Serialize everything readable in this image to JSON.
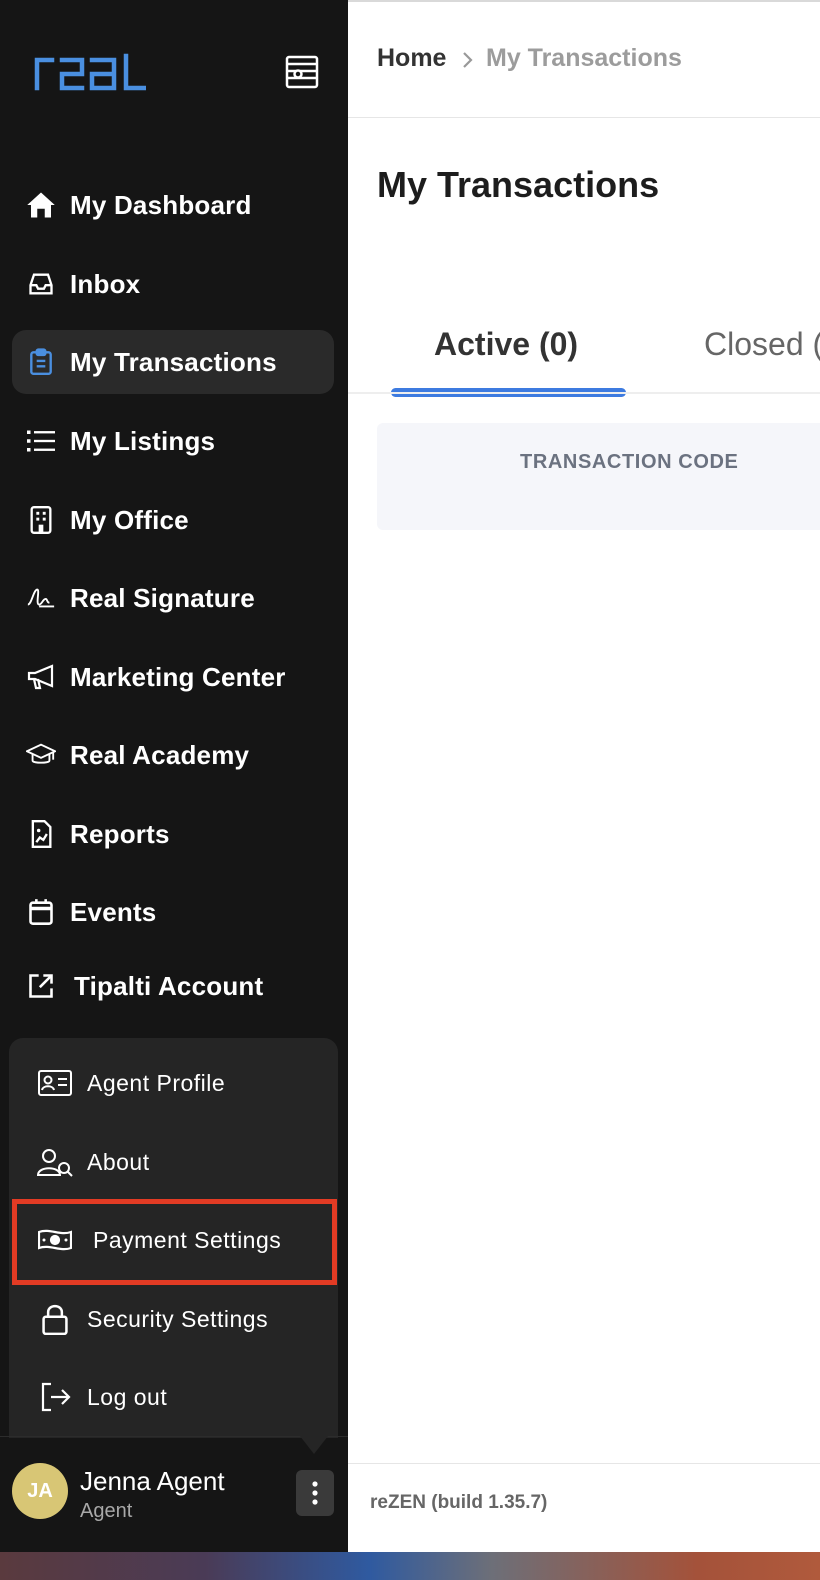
{
  "sidebar": {
    "logo_text": "real",
    "nav": [
      {
        "label": "My Dashboard",
        "icon": "home-icon"
      },
      {
        "label": "Inbox",
        "icon": "inbox-icon"
      },
      {
        "label": "My Transactions",
        "icon": "clipboard-icon",
        "active": true
      },
      {
        "label": "My Listings",
        "icon": "list-icon"
      },
      {
        "label": "My Office",
        "icon": "building-icon"
      },
      {
        "label": "Real Signature",
        "icon": "signature-icon"
      },
      {
        "label": "Marketing Center",
        "icon": "megaphone-icon"
      },
      {
        "label": "Real Academy",
        "icon": "graduation-cap-icon"
      },
      {
        "label": "Reports",
        "icon": "report-icon"
      },
      {
        "label": "Events",
        "icon": "calendar-icon"
      },
      {
        "label": "Tipalti Account",
        "icon": "external-link-icon"
      }
    ],
    "user_menu": [
      {
        "label": "Agent Profile",
        "icon": "id-card-icon"
      },
      {
        "label": "About",
        "icon": "user-search-icon"
      },
      {
        "label": "Payment Settings",
        "icon": "money-icon",
        "highlighted": true
      },
      {
        "label": "Security Settings",
        "icon": "lock-icon"
      },
      {
        "label": "Log out",
        "icon": "logout-icon"
      }
    ],
    "user": {
      "initials": "JA",
      "name": "Jenna Agent",
      "role": "Agent"
    }
  },
  "breadcrumb": {
    "home": "Home",
    "current": "My Transactions"
  },
  "page_title": "My Transactions",
  "tabs": {
    "active": "Active (0)",
    "closed": "Closed ("
  },
  "table": {
    "columns": [
      "TRANSACTION CODE"
    ]
  },
  "footer": {
    "build": "reZEN (build 1.35.7)"
  },
  "colors": {
    "accent": "#3d7be0",
    "logo": "#4a8fe0",
    "highlight": "#e23b24",
    "avatar": "#d8c675",
    "sidebar": "#151515"
  }
}
